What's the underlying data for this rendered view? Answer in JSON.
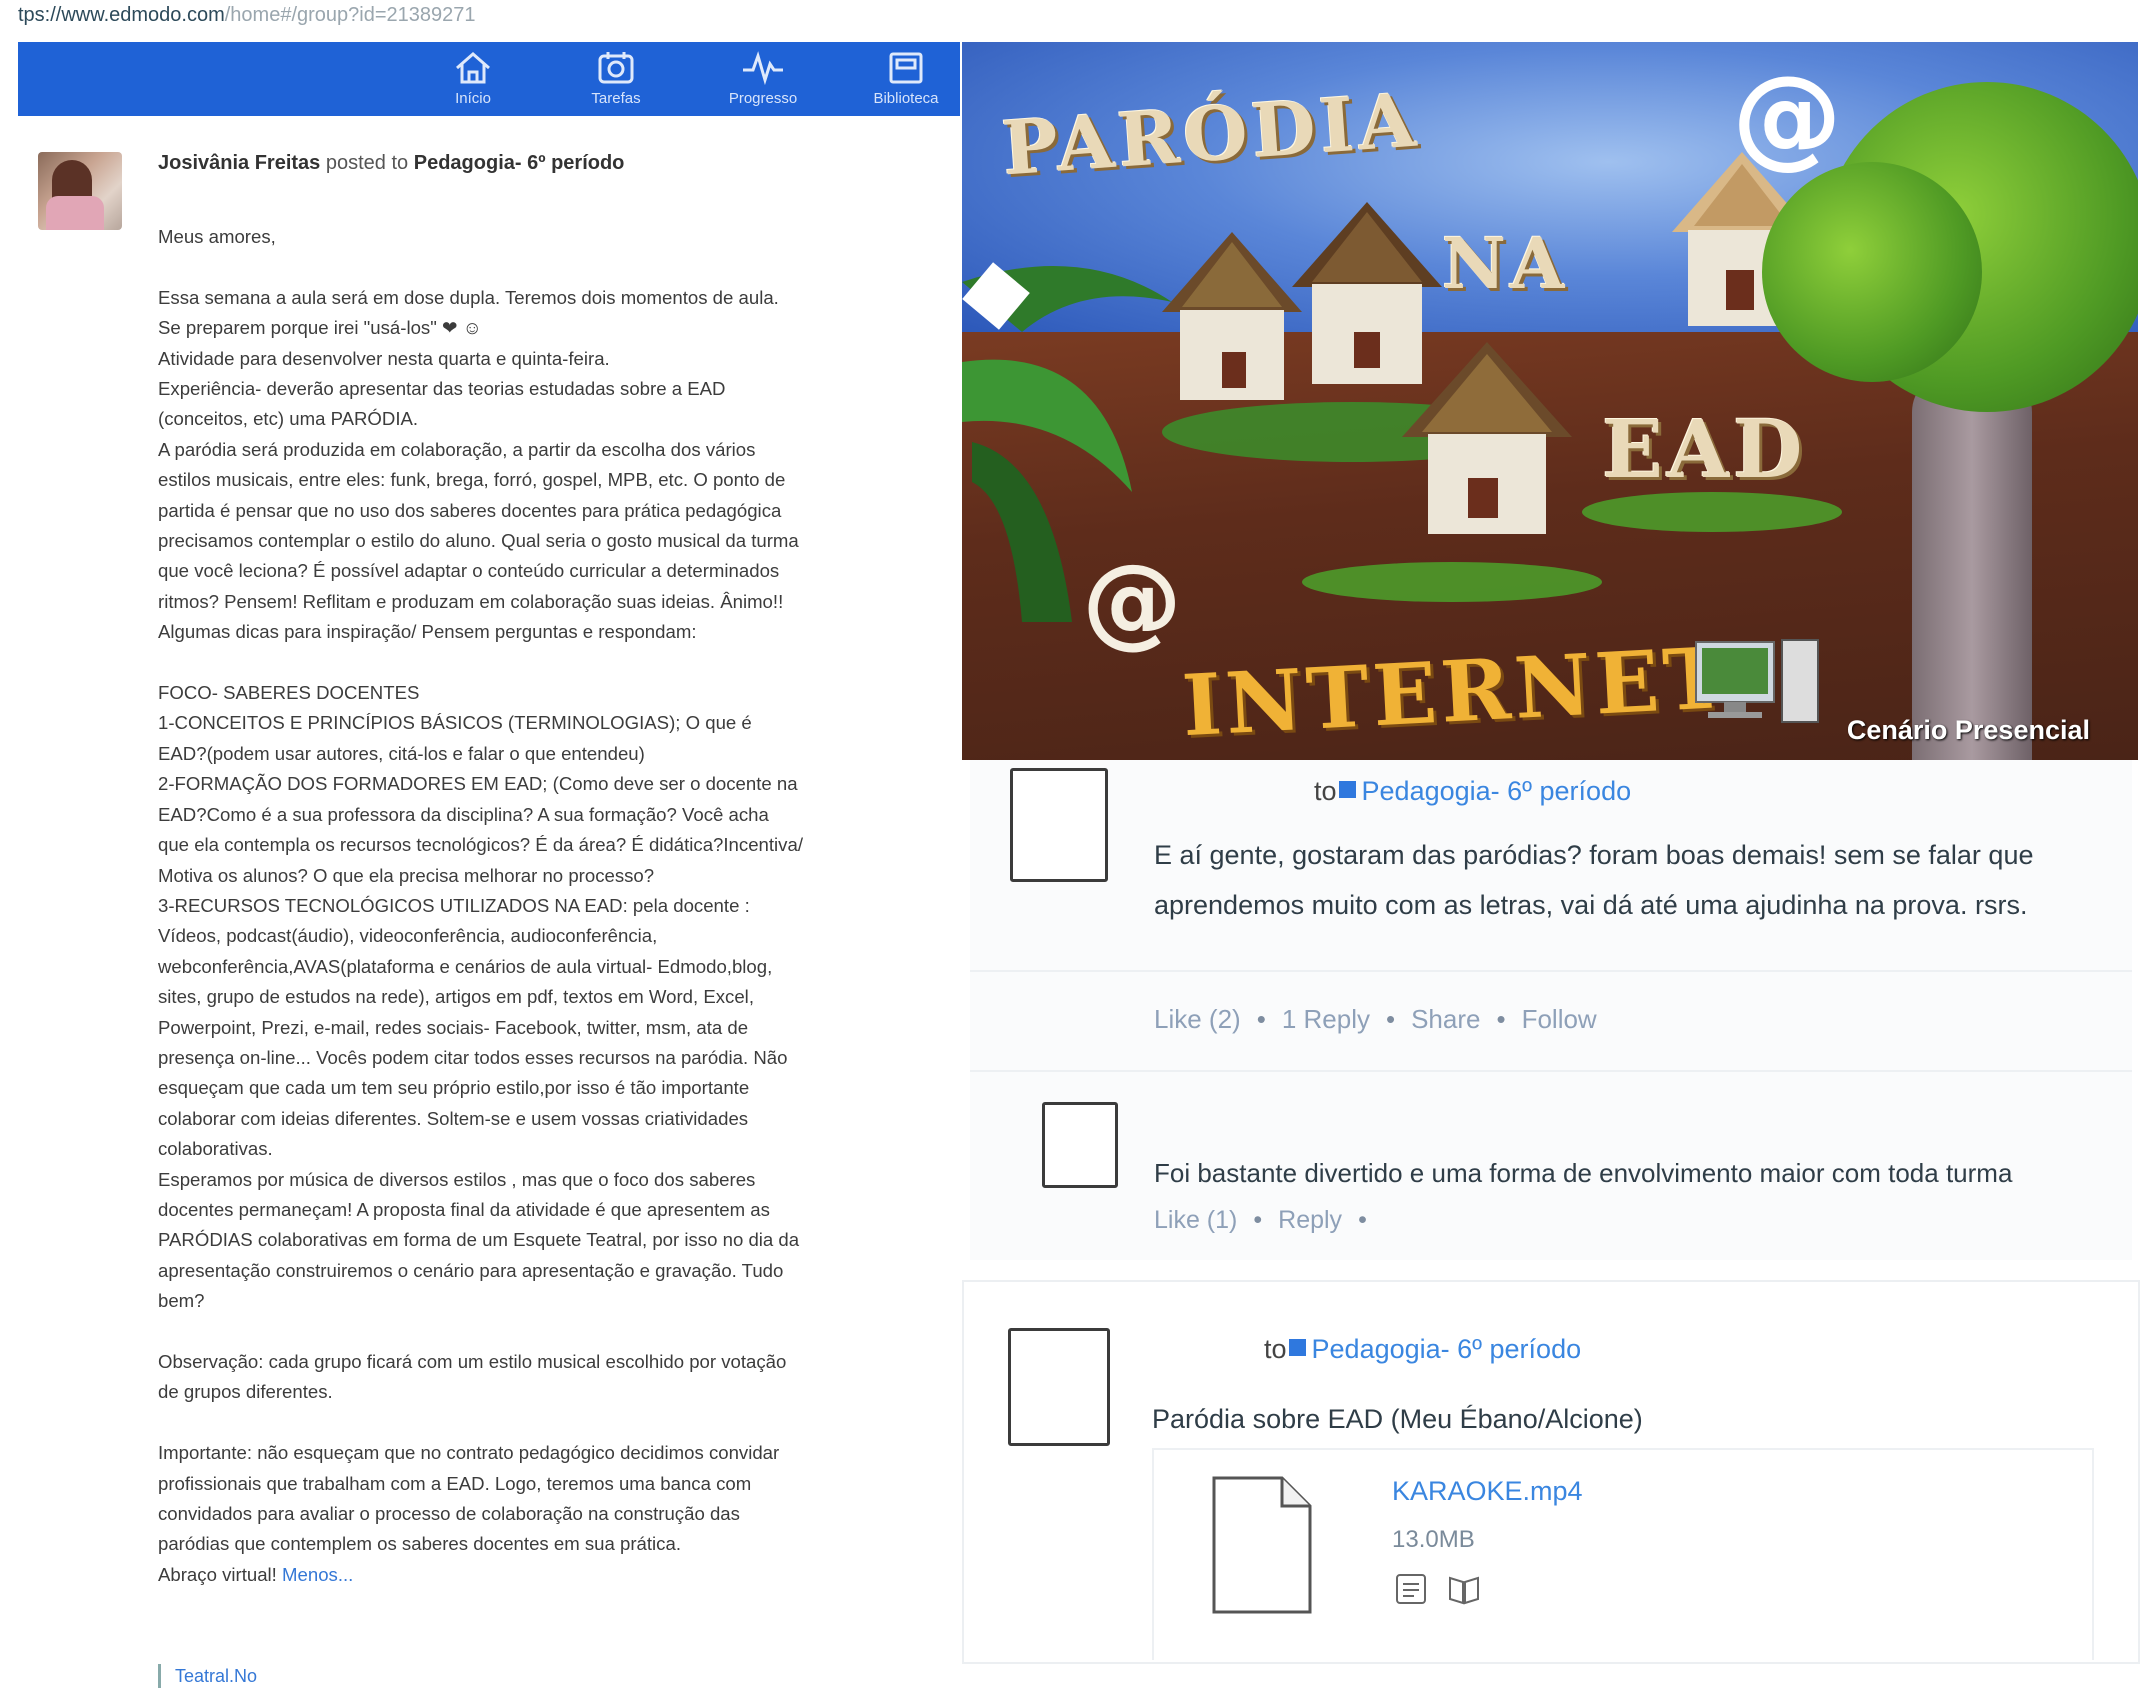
{
  "browser": {
    "url_prefix": "tps://www.edmodo.com",
    "url_path": "/home#/group?id=21389271"
  },
  "nav": {
    "items": [
      {
        "label": "Início",
        "icon": "home-icon"
      },
      {
        "label": "Tarefas",
        "icon": "planner-icon"
      },
      {
        "label": "Progresso",
        "icon": "progress-icon"
      },
      {
        "label": "Biblioteca",
        "icon": "library-icon"
      }
    ]
  },
  "post": {
    "author": "Josivânia Freitas",
    "posted_to_text": "posted to",
    "group": "Pedagogia- 6º período",
    "lines": [
      "Meus amores,",
      "",
      "Essa semana a aula será em dose dupla. Teremos dois momentos de aula.",
      "Se preparem porque irei \"usá-los\" ❤ ☺",
      "Atividade para desenvolver nesta quarta e quinta-feira.",
      "Experiência- deverão apresentar das teorias estudadas sobre a EAD",
      "(conceitos, etc) uma PARÓDIA.",
      "A paródia será produzida em colaboração, a partir da escolha dos vários",
      "estilos musicais, entre eles: funk, brega, forró, gospel, MPB, etc. O ponto de",
      "partida é pensar que no uso dos saberes docentes para prática pedagógica",
      "precisamos contemplar o estilo do aluno. Qual seria o gosto musical da turma",
      "que você leciona? É possível adaptar o conteúdo curricular a determinados",
      "ritmos? Pensem! Reflitam e produzam em colaboração suas ideias. Ânimo!!",
      "Algumas dicas para inspiração/ Pensem perguntas e respondam:",
      "",
      "FOCO- SABERES DOCENTES",
      "1-CONCEITOS E PRINCÍPIOS BÁSICOS (TERMINOLOGIAS); O que é",
      "EAD?(podem usar autores, citá-los e falar o que entendeu)",
      "2-FORMAÇÃO DOS FORMADORES EM EAD; (Como deve ser o docente na",
      "EAD?Como é a sua professora da disciplina? A sua formação? Você acha",
      "que ela contempla os recursos tecnológicos? É da área? É didática?Incentiva/",
      "Motiva os alunos? O que ela precisa melhorar no processo?",
      "3-RECURSOS TECNOLÓGICOS UTILIZADOS NA EAD: pela docente :",
      "Vídeos, podcast(áudio), videoconferência, audioconferência,",
      "webconferência,AVAS(plataforma e cenários de aula virtual- Edmodo,blog,",
      "sites, grupo de estudos na rede), artigos em pdf, textos em Word, Excel,",
      "Powerpoint, Prezi, e-mail, redes sociais- Facebook, twitter, msm, ata de",
      "presença on-line... Vocês podem citar todos esses recursos na paródia. Não",
      "esqueçam que cada um tem seu próprio estilo,por isso é tão importante",
      "colaborar com ideias diferentes. Soltem-se e usem vossas criatividades",
      "colaborativas.",
      "Esperamos por música de diversos estilos , mas que o foco dos saberes",
      "docentes permaneçam! A proposta final da atividade é que apresentem as",
      "PARÓDIAS colaborativas em forma de um Esquete Teatral, por isso no dia da",
      "apresentação construiremos o cenário para apresentação e gravação. Tudo",
      "bem?",
      "",
      "Observação: cada grupo ficará com um estilo musical escolhido por votação",
      "de grupos diferentes.",
      "",
      "Importante: não esqueçam que no contrato pedagógico decidimos convidar",
      "profissionais que trabalham com a EAD. Logo, teremos uma banca com",
      "convidados para avaliar o processo de colaboração na construção das",
      "paródias que contemplem os saberes docentes em sua prática."
    ],
    "last_line": "Abraço virtual!",
    "less_link": "Menos...",
    "attachment": "Teatral.No"
  },
  "poster": {
    "title_1": "PARÓDIA",
    "title_2": "NA",
    "title_3": "EAD",
    "title_4": "INTERNET",
    "at_symbol": "@",
    "caption": "Cenário Presencial"
  },
  "reply_post": {
    "to": "to",
    "group": "Pedagogia- 6º período",
    "message_line1": "E aí gente, gostaram das paródias? foram boas demais! sem se falar que",
    "message_line2": "aprendemos muito com as letras, vai dá até uma ajudinha na prova. rsrs.",
    "like": "Like (2)",
    "reply": "1 Reply",
    "share": "Share",
    "follow": "Follow",
    "comment": {
      "text": "Foi bastante divertido e uma forma de envolvimento maior com toda turma",
      "like": "Like (1)",
      "reply": "Reply"
    }
  },
  "file_post": {
    "to": "to",
    "group": "Pedagogia- 6º período",
    "message": "Paródia sobre EAD (Meu Ébano/Alcione)",
    "file_name": "KARAOKE.mp4",
    "file_size": "13.0MB"
  },
  "colors": {
    "nav_blue": "#1f62d6",
    "link_blue": "#3a86e0"
  }
}
